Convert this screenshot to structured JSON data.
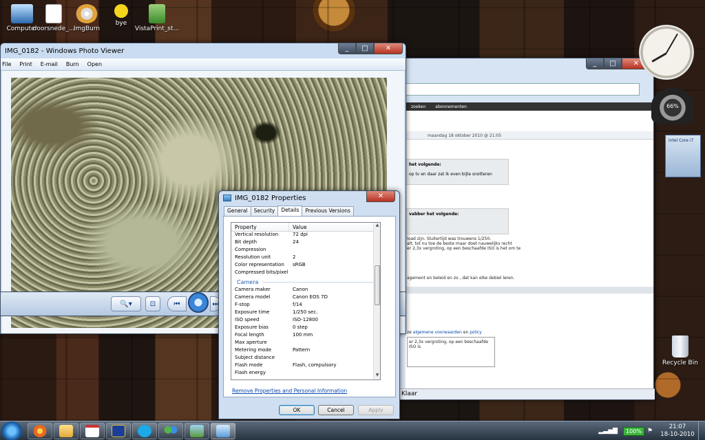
{
  "desktop": {
    "icons": [
      {
        "label": "Computer"
      },
      {
        "label": "doorsnede_..."
      },
      {
        "label": "ImgBurn"
      },
      {
        "label": "bye"
      },
      {
        "label": "VistaPrint_st..."
      },
      {
        "label": "Recycle Bin"
      }
    ],
    "meter_value": "66%"
  },
  "browser": {
    "forum_nav": [
      "zoeken",
      "abonnementen"
    ],
    "post_header": "maandag 18 oktober 2010 @ 21:05",
    "quote1": "het volgende:",
    "text1": "op tv en daar zat ik even bijte snotteren",
    "quote2": "vabber het volgende:",
    "text2": "load zijn. Sluitertijd was trouwens 1/250,",
    "text3": "alt, tot nu toe de beste maar doet nauwelijks recht",
    "text4": "er 2,3x vergroting, op een beschaafde ISO is het om te",
    "text5": "agement en beleid en zo , dat kan elke debiel leren.",
    "terms": "algemene voorwaarden",
    "terms_and": "en",
    "policy": "policy",
    "terms_pre": "ze",
    "textarea": "er 2,3x vergroting, op een beschaafde ISO is",
    "status": "Klaar"
  },
  "viewer": {
    "title": "IMG_0182 - Windows Photo Viewer",
    "menu": [
      "File",
      "Print",
      "E-mail",
      "Burn",
      "Open"
    ]
  },
  "dialog": {
    "title": "IMG_0182 Properties",
    "tabs": [
      "General",
      "Security",
      "Details",
      "Previous Versions"
    ],
    "columns": {
      "property": "Property",
      "value": "Value"
    },
    "rows_top": [
      {
        "k": "Vertical resolution",
        "v": "72 dpi"
      },
      {
        "k": "Bit depth",
        "v": "24"
      },
      {
        "k": "Compression",
        "v": ""
      },
      {
        "k": "Resolution unit",
        "v": "2"
      },
      {
        "k": "Color representation",
        "v": "sRGB"
      },
      {
        "k": "Compressed bits/pixel",
        "v": ""
      }
    ],
    "group_camera": "Camera",
    "rows_camera": [
      {
        "k": "Camera maker",
        "v": "Canon"
      },
      {
        "k": "Camera model",
        "v": "Canon EOS 7D"
      },
      {
        "k": "F-stop",
        "v": "f/14"
      },
      {
        "k": "Exposure time",
        "v": "1/250 sec."
      },
      {
        "k": "ISO speed",
        "v": "ISO-12800"
      },
      {
        "k": "Exposure bias",
        "v": "0 step"
      },
      {
        "k": "Focal length",
        "v": "100 mm"
      },
      {
        "k": "Max aperture",
        "v": ""
      },
      {
        "k": "Metering mode",
        "v": "Pattern"
      },
      {
        "k": "Subject distance",
        "v": ""
      },
      {
        "k": "Flash mode",
        "v": "Flash, compulsory"
      },
      {
        "k": "Flash energy",
        "v": ""
      }
    ],
    "remove_link": "Remove Properties and Personal Information",
    "ok": "OK",
    "cancel": "Cancel",
    "apply": "Apply"
  },
  "taskbar": {
    "battery": "100%",
    "time": "21:07",
    "date": "18-10-2010"
  },
  "colors": {
    "link": "#0645ad",
    "group_header": "#1e5bb8",
    "battery": "#3db43d"
  }
}
